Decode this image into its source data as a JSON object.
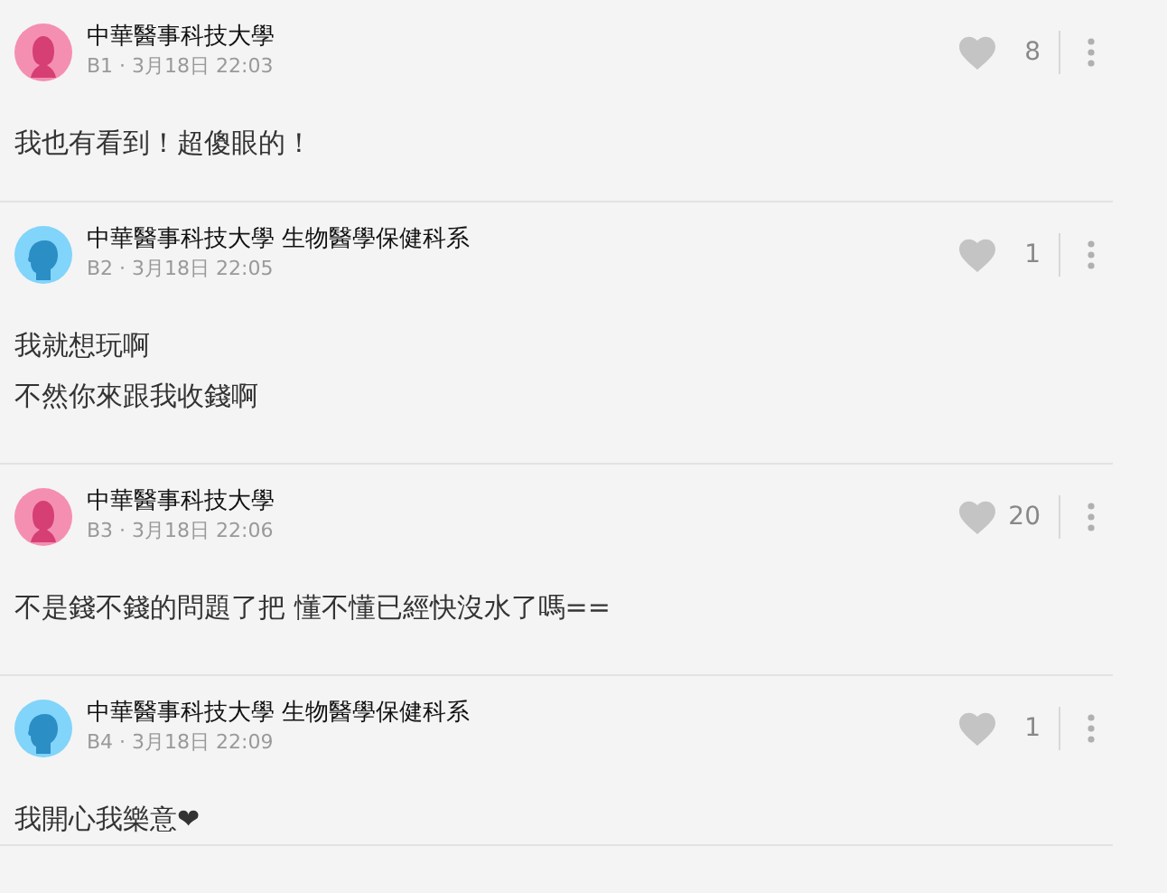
{
  "comments": [
    {
      "avatar": {
        "kind": "female"
      },
      "author": "中華醫事科技大學",
      "byline": "B1 · 3月18日 22:03",
      "likes": "8",
      "lines": [
        "我也有看到！超傻眼的！"
      ]
    },
    {
      "avatar": {
        "kind": "male"
      },
      "author": "中華醫事科技大學 生物醫學保健科系",
      "byline": "B2 · 3月18日 22:05",
      "likes": "1",
      "lines": [
        "我就想玩啊",
        "不然你來跟我收錢啊"
      ]
    },
    {
      "avatar": {
        "kind": "female"
      },
      "author": "中華醫事科技大學",
      "byline": "B3 · 3月18日 22:06",
      "likes": "20",
      "lines": [
        "不是錢不錢的問題了把  懂不懂已經快沒水了嗎=="
      ]
    },
    {
      "avatar": {
        "kind": "male"
      },
      "author": "中華醫事科技大學 生物醫學保健科系",
      "byline": "B4 · 3月18日 22:09",
      "likes": "1",
      "lines": [
        "我開心我樂意❤"
      ]
    }
  ]
}
